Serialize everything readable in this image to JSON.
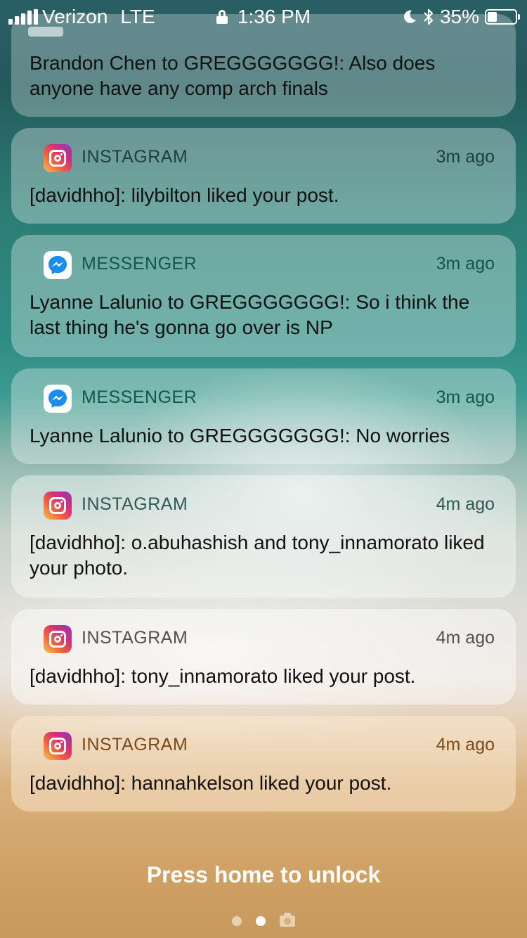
{
  "status_bar": {
    "carrier": "Verizon",
    "network": "LTE",
    "time": "1:36 PM",
    "battery": "35%",
    "battery_level": 0.35
  },
  "notifications": [
    {
      "app": "",
      "time": "",
      "text": "Brandon Chen to GREGGGGGGG!: Also does anyone have any comp arch finals",
      "icon": "messenger-icon",
      "color": "#1a3a3d"
    },
    {
      "app": "INSTAGRAM",
      "time": "3m ago",
      "text": "[davidhho]: lilybilton liked your post.",
      "icon": "instagram-icon",
      "color": "#1d3f3f"
    },
    {
      "app": "MESSENGER",
      "time": "3m ago",
      "text": "Lyanne Lalunio to GREGGGGGGG!: So i think the last thing he's gonna go over is NP",
      "icon": "messenger-icon",
      "color": "#10574d"
    },
    {
      "app": "MESSENGER",
      "time": "3m ago",
      "text": "Lyanne Lalunio to GREGGGGGGG!: No worries",
      "icon": "messenger-icon",
      "color": "#10574d"
    },
    {
      "app": "INSTAGRAM",
      "time": "4m ago",
      "text": "[davidhho]: o.abuhashish and tony_innamorato liked your photo.",
      "icon": "instagram-icon",
      "color": "#2e5a52"
    },
    {
      "app": "INSTAGRAM",
      "time": "4m ago",
      "text": "[davidhho]: tony_innamorato liked your post.",
      "icon": "instagram-icon",
      "color": "#55504d"
    },
    {
      "app": "INSTAGRAM",
      "time": "4m ago",
      "text": "[davidhho]: hannahkelson liked your post.",
      "icon": "instagram-icon",
      "color": "#7a4a1a"
    }
  ],
  "unlock_hint": "Press home to unlock",
  "pager": {
    "pages": 2,
    "active": 2,
    "camera_icon": "camera-icon"
  }
}
